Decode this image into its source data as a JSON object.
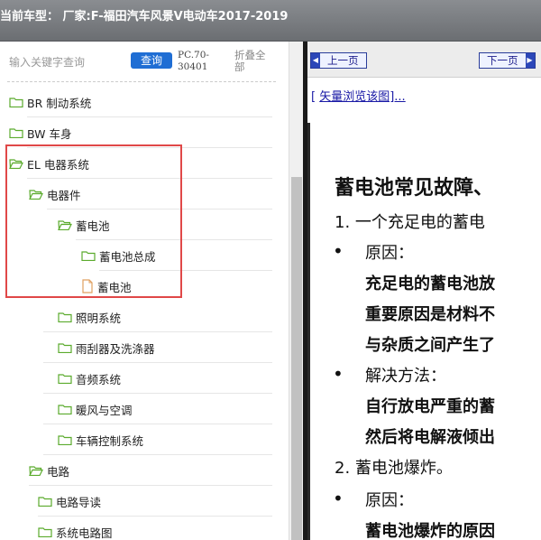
{
  "window": {
    "title": "当前车型：  厂家:F-福田汽车风景V电动车2017-2019"
  },
  "search": {
    "placeholder": "输入关键字查询",
    "query_label": "查询",
    "pc_code": "PC.70-30401",
    "collapse_all_label": "折叠全部"
  },
  "tree": {
    "items": [
      {
        "label": "BR 制动系统",
        "icon": "folder-icon"
      },
      {
        "label": "BW 车身",
        "icon": "folder-icon"
      },
      {
        "label": "EL 电器系统",
        "icon": "folder-icon"
      },
      {
        "label": "电器件",
        "icon": "folder-icon"
      },
      {
        "label": "蓄电池",
        "icon": "folder-icon"
      },
      {
        "label": "蓄电池总成",
        "icon": "folder-icon"
      },
      {
        "label": "蓄电池",
        "icon": "document-icon"
      },
      {
        "label": "照明系统",
        "icon": "folder-icon"
      },
      {
        "label": "雨刮器及洗涤器",
        "icon": "folder-icon"
      },
      {
        "label": "音频系统",
        "icon": "folder-icon"
      },
      {
        "label": "暖风与空调",
        "icon": "folder-icon"
      },
      {
        "label": "车辆控制系统",
        "icon": "folder-icon"
      },
      {
        "label": "电路",
        "icon": "folder-icon"
      },
      {
        "label": "电路导读",
        "icon": "folder-icon"
      },
      {
        "label": "系统电路图",
        "icon": "folder-icon"
      }
    ]
  },
  "viewer": {
    "prev_label": "上一页",
    "next_label": "下一页",
    "vector_link_prefix": "[",
    "vector_link_label": "矢量浏览该图]...",
    "content": {
      "title": "蓄电池常见故障、",
      "lines": [
        "1. 一个充足电的蓄电",
        "原因：",
        "充足电的蓄电池放",
        "重要原因是材料不",
        "与杂质之间产生了",
        "解决方法：",
        "自行放电严重的蓄",
        "然后将电解液倾出",
        "2. 蓄电池爆炸。",
        "原因：",
        "蓄电池爆炸的原因"
      ]
    }
  },
  "colors": {
    "accent": "#1f6ed4",
    "highlight": "#e04848",
    "folder": "#7fc74a"
  }
}
